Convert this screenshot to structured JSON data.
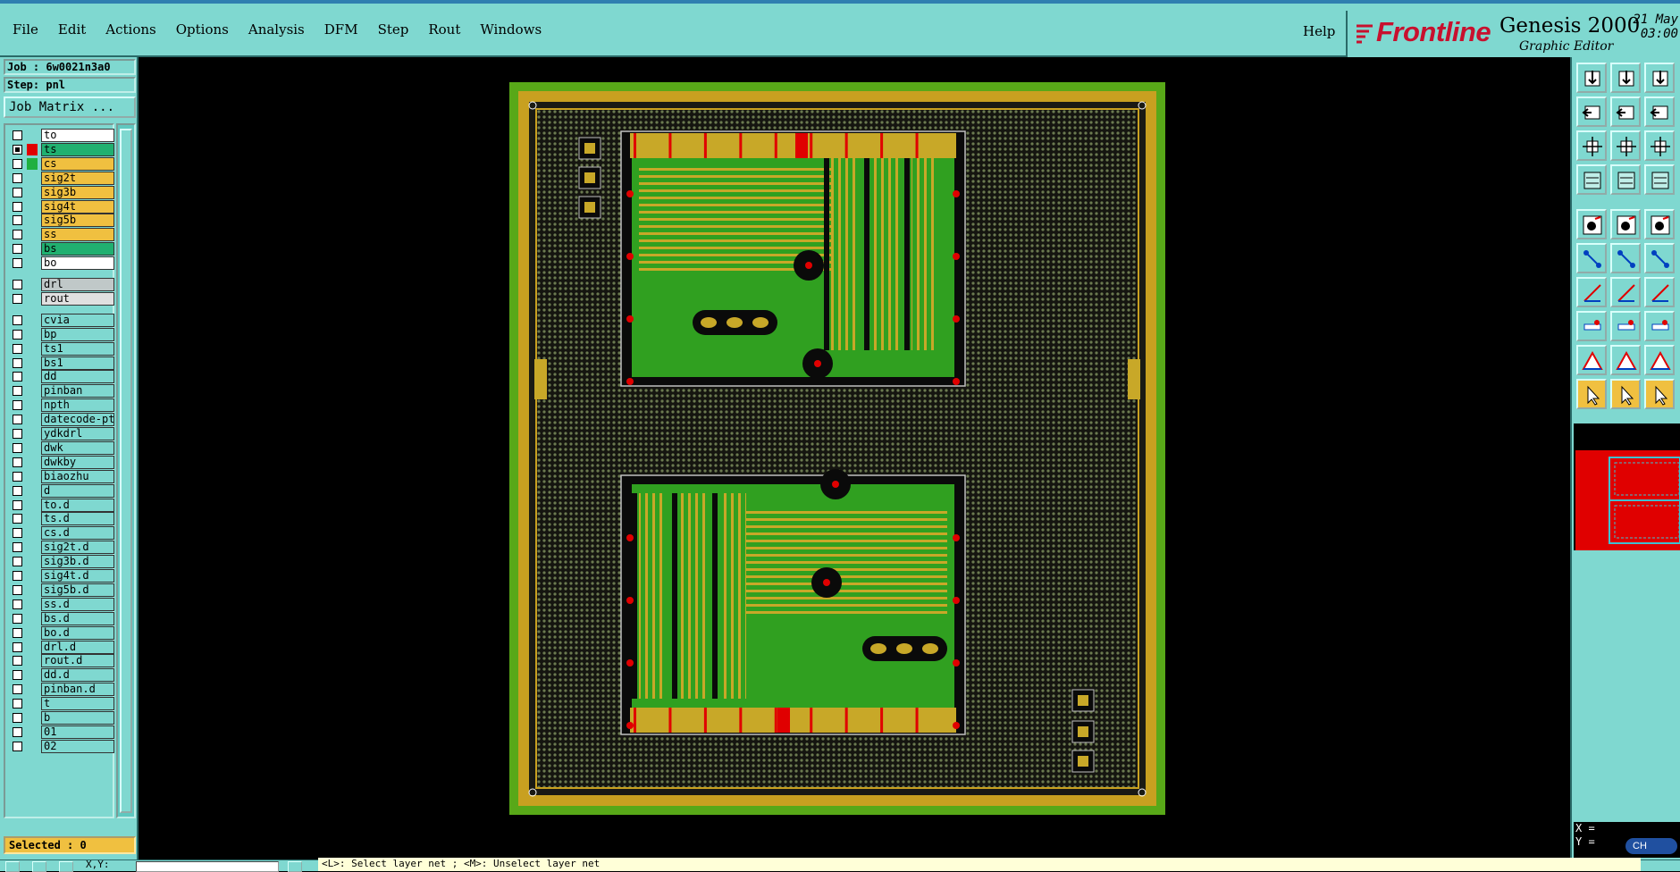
{
  "menu": {
    "items": [
      "File",
      "Edit",
      "Actions",
      "Options",
      "Analysis",
      "DFM",
      "Step",
      "Rout",
      "Windows"
    ],
    "help": "Help"
  },
  "brand": {
    "name": "Frontline",
    "product": "Genesis 2000",
    "subtitle": "Graphic Editor",
    "date_line1": "21 May",
    "date_line2": "03:00"
  },
  "job": {
    "job_label": "Job : 6w0021n3a0",
    "step_label": "Step: pnl",
    "matrix_button": "Job Matrix ..."
  },
  "layers": [
    {
      "name": "to",
      "color": "#ffffff",
      "checked": false,
      "swatch": ""
    },
    {
      "name": "ts",
      "color": "#20b070",
      "checked": true,
      "swatch": "#e00000"
    },
    {
      "name": "cs",
      "color": "#f0c040",
      "checked": false,
      "swatch": "#20b040"
    },
    {
      "name": "sig2t",
      "color": "#f0c040",
      "checked": false,
      "swatch": ""
    },
    {
      "name": "sig3b",
      "color": "#f0c040",
      "checked": false,
      "swatch": ""
    },
    {
      "name": "sig4t",
      "color": "#f0c040",
      "checked": false,
      "swatch": ""
    },
    {
      "name": "sig5b",
      "color": "#f0c040",
      "checked": false,
      "swatch": ""
    },
    {
      "name": "ss",
      "color": "#f0c040",
      "checked": false,
      "swatch": ""
    },
    {
      "name": "bs",
      "color": "#20b070",
      "checked": false,
      "swatch": ""
    },
    {
      "name": "bo",
      "color": "#ffffff",
      "checked": false,
      "swatch": ""
    },
    {
      "name": "drl",
      "color": "#c0c8c8",
      "checked": false,
      "swatch": ""
    },
    {
      "name": "rout",
      "color": "#e0e0e0",
      "checked": false,
      "swatch": ""
    },
    {
      "name": "cvia",
      "color": "#7fd8d0",
      "checked": false,
      "swatch": ""
    },
    {
      "name": "bp",
      "color": "#7fd8d0",
      "checked": false,
      "swatch": ""
    },
    {
      "name": "ts1",
      "color": "#7fd8d0",
      "checked": false,
      "swatch": ""
    },
    {
      "name": "bs1",
      "color": "#7fd8d0",
      "checked": false,
      "swatch": ""
    },
    {
      "name": "dd",
      "color": "#7fd8d0",
      "checked": false,
      "swatch": ""
    },
    {
      "name": "pinban",
      "color": "#7fd8d0",
      "checked": false,
      "swatch": ""
    },
    {
      "name": "npth",
      "color": "#7fd8d0",
      "checked": false,
      "swatch": ""
    },
    {
      "name": "datecode-pt",
      "color": "#7fd8d0",
      "checked": false,
      "swatch": ""
    },
    {
      "name": "ydkdrl",
      "color": "#7fd8d0",
      "checked": false,
      "swatch": ""
    },
    {
      "name": "dwk",
      "color": "#7fd8d0",
      "checked": false,
      "swatch": ""
    },
    {
      "name": "dwkby",
      "color": "#7fd8d0",
      "checked": false,
      "swatch": ""
    },
    {
      "name": "biaozhu",
      "color": "#7fd8d0",
      "checked": false,
      "swatch": ""
    },
    {
      "name": "d",
      "color": "#7fd8d0",
      "checked": false,
      "swatch": ""
    },
    {
      "name": "to.d",
      "color": "#7fd8d0",
      "checked": false,
      "swatch": ""
    },
    {
      "name": "ts.d",
      "color": "#7fd8d0",
      "checked": false,
      "swatch": ""
    },
    {
      "name": "cs.d",
      "color": "#7fd8d0",
      "checked": false,
      "swatch": ""
    },
    {
      "name": "sig2t.d",
      "color": "#7fd8d0",
      "checked": false,
      "swatch": ""
    },
    {
      "name": "sig3b.d",
      "color": "#7fd8d0",
      "checked": false,
      "swatch": ""
    },
    {
      "name": "sig4t.d",
      "color": "#7fd8d0",
      "checked": false,
      "swatch": ""
    },
    {
      "name": "sig5b.d",
      "color": "#7fd8d0",
      "checked": false,
      "swatch": ""
    },
    {
      "name": "ss.d",
      "color": "#7fd8d0",
      "checked": false,
      "swatch": ""
    },
    {
      "name": "bs.d",
      "color": "#7fd8d0",
      "checked": false,
      "swatch": ""
    },
    {
      "name": "bo.d",
      "color": "#7fd8d0",
      "checked": false,
      "swatch": ""
    },
    {
      "name": "drl.d",
      "color": "#7fd8d0",
      "checked": false,
      "swatch": ""
    },
    {
      "name": "rout.d",
      "color": "#7fd8d0",
      "checked": false,
      "swatch": ""
    },
    {
      "name": "dd.d",
      "color": "#7fd8d0",
      "checked": false,
      "swatch": ""
    },
    {
      "name": "pinban.d",
      "color": "#7fd8d0",
      "checked": false,
      "swatch": ""
    },
    {
      "name": "t",
      "color": "#7fd8d0",
      "checked": false,
      "swatch": ""
    },
    {
      "name": "b",
      "color": "#7fd8d0",
      "checked": false,
      "swatch": ""
    },
    {
      "name": "01",
      "color": "#7fd8d0",
      "checked": false,
      "swatch": ""
    },
    {
      "name": "02",
      "color": "#7fd8d0",
      "checked": false,
      "swatch": ""
    }
  ],
  "selected_label": "Selected : 0",
  "toolbar_icons": [
    "top-view-icon",
    "bottom-view-icon",
    "home-icon",
    "pan-left-icon",
    "pan-right-icon",
    "redraw-icon",
    "zoom-fit-icon",
    "zoom-home-icon",
    "zoom-1to2-icon",
    "measure-icon",
    "grid-icon",
    "snap-icon",
    "add-pad-icon",
    "add-line-icon",
    "ruler-icon",
    "connect-icon",
    "cross-icon",
    "arc-icon",
    "draw-line-icon",
    "draw-diagonal-icon",
    "rotate-icon",
    "node-icon",
    "segment-icon",
    "component-icon",
    "shape-triangle-icon",
    "shape-triangle-red-icon",
    "shape-triangle-outline-icon",
    "pointer-icon",
    "pointer-select-icon",
    "pointer-edit-icon"
  ],
  "coords": {
    "x_label": "X =",
    "y_label": "Y ="
  },
  "ime_label": "CH",
  "status": {
    "xy_label": "X,Y:",
    "message": "<L>: Select layer net ; <M>: Unselect layer net"
  },
  "colors": {
    "ui_bg": "#7fd8d0",
    "board_frame": "#58a818",
    "board_inner": "#c8a020",
    "copper_green": "#30a020",
    "copper_yellow": "#c8a828",
    "pad_red": "#e00000"
  }
}
